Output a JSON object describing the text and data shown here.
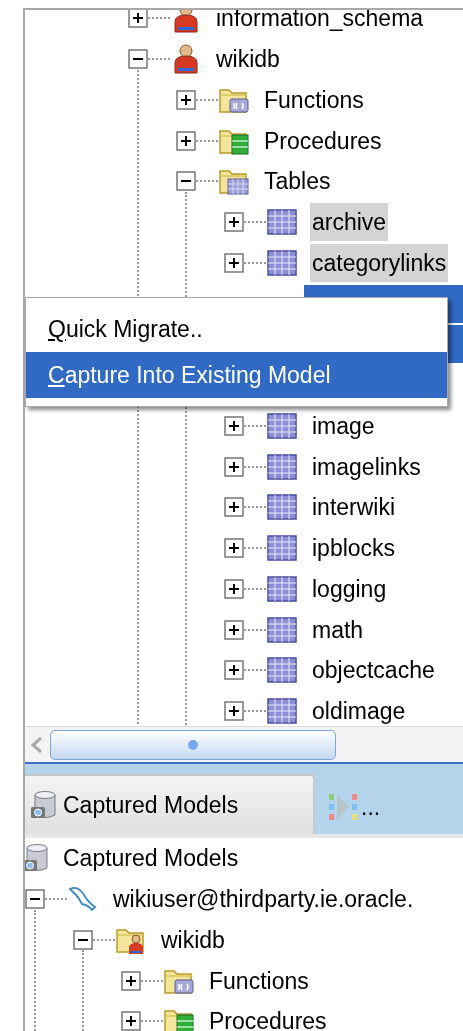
{
  "top_tree": [
    {
      "label": "information_schema",
      "kind": "schema",
      "expanded": false,
      "selected": false
    },
    {
      "label": "wikidb",
      "kind": "schema",
      "expanded": true,
      "selected": false,
      "children": [
        {
          "label": "Functions",
          "kind": "functions",
          "expanded": false,
          "selected": false
        },
        {
          "label": "Procedures",
          "kind": "procedures",
          "expanded": false,
          "selected": false
        },
        {
          "label": "Tables",
          "kind": "tables",
          "expanded": true,
          "selected": false,
          "children": [
            {
              "kind": "table",
              "label": "archive",
              "expanded": false,
              "selected": true
            },
            {
              "kind": "table",
              "label": "categorylinks",
              "expanded": false,
              "selected": true
            },
            {
              "kind": "covered",
              "selected": true
            },
            {
              "kind": "covered",
              "selected": true
            },
            {
              "kind": "covered",
              "selected": false
            },
            {
              "kind": "table",
              "label": "image",
              "expanded": false,
              "selected": false
            },
            {
              "kind": "table",
              "label": "imagelinks",
              "expanded": false,
              "selected": false
            },
            {
              "kind": "table",
              "label": "interwiki",
              "expanded": false,
              "selected": false
            },
            {
              "kind": "table",
              "label": "ipblocks",
              "expanded": false,
              "selected": false
            },
            {
              "kind": "table",
              "label": "logging",
              "expanded": false,
              "selected": false
            },
            {
              "kind": "table",
              "label": "math",
              "expanded": false,
              "selected": false
            },
            {
              "kind": "table",
              "label": "objectcache",
              "expanded": false,
              "selected": false
            },
            {
              "kind": "table",
              "label": "oldimage",
              "expanded": false,
              "selected": false
            }
          ]
        }
      ]
    }
  ],
  "context_menu": [
    {
      "label": "Quick Migrate..",
      "underline_first": true,
      "selected": false
    },
    {
      "label": "Capture Into Existing Model",
      "underline_first": true,
      "selected": true
    }
  ],
  "tabs": [
    {
      "label": "Captured Models",
      "kind": "db",
      "selected": true
    },
    {
      "label": "...",
      "kind": "stepper",
      "selected": false
    }
  ],
  "bottom_tree": {
    "label": "Captured Models",
    "kind": "db",
    "children": [
      {
        "label": "wikiuser@thirdparty.ie.oracle.",
        "kind": "connection",
        "expanded": true,
        "selected": false,
        "children": [
          {
            "label": "wikidb",
            "kind": "schema-folder",
            "expanded": true,
            "selected": false,
            "children": [
              {
                "label": "Functions",
                "kind": "functions",
                "expanded": false,
                "selected": false
              },
              {
                "label": "Procedures",
                "kind": "procedures",
                "expanded": false,
                "selected": false
              }
            ]
          }
        ]
      }
    ]
  }
}
